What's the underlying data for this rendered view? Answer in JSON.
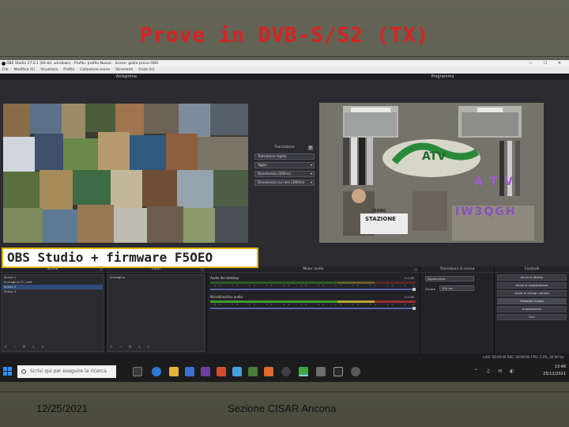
{
  "slide": {
    "title": "Prove in DVB-S/S2 (TX)",
    "callout": "OBS Studio + firmware F5OEO",
    "footer_date": "12/25/2021",
    "footer_center": "Sezione CISAR Ancona"
  },
  "window": {
    "title": "OBS Studio 27.0.1 (64-bit, windows) - Profilo: profilo-Nuovo - Scene: giallo-prova-OBS",
    "controls": "—  ☐  ✕"
  },
  "menu": [
    "File",
    "Modifica (E)",
    "Visualizza",
    "Profilo",
    "Collezione scene",
    "Strumenti",
    "Aiuto (H)"
  ],
  "panels": {
    "preview": "Anteprima",
    "program": "Programma"
  },
  "transition": {
    "header": "Transizione",
    "items": [
      "Transizione rapida",
      "Taglio",
      "Dissolvenza (300ms)",
      "Dissolvenza sul nero (300ms)"
    ]
  },
  "docks": {
    "scenes": {
      "title": "Scene",
      "items": [
        "Scena 1",
        "Immagine F5 / relè",
        "Scena 2",
        "Scena 3"
      ]
    },
    "sources": {
      "title": "Fonti",
      "items": [
        "Immagine"
      ]
    },
    "mixer": {
      "title": "Mixer audio",
      "channels": [
        {
          "name": "Audio del desktop",
          "db": "0.0 dB"
        },
        {
          "name": "Microfono/Aux audio",
          "db": "0.0 dB"
        }
      ],
      "scale": "-60 -55 -50 -45 -40 -35 -30 -25 -20 -15 -10 -5 0"
    },
    "transitions": {
      "title": "Transizioni di scena",
      "type": "Dissolvenza",
      "duration_label": "Durata",
      "duration": "300 ms"
    },
    "controls": {
      "title": "Controlli",
      "buttons": [
        "Avvia la diretta",
        "Avvia la registrazione",
        "Avvia la virtual camera",
        "Modalità Studio",
        "Impostazioni",
        "Esci"
      ]
    }
  },
  "status": {
    "text": "LIVE: 00:00:00   REC: 00:00:00   CPU: 2.2%, 30.00 fps"
  },
  "taskbar": {
    "search_placeholder": "Scrivi qui per eseguire la ricerca",
    "time": "13:48",
    "date": "25/12/2021"
  },
  "program_overlay": {
    "callsign_top": "I3ANG",
    "stazione": "STAZIONE",
    "atv": "ATV",
    "side_text": "A T V",
    "call_right": "IW3QGH"
  },
  "colors": {
    "title_red": "#d92222",
    "callout_border": "#e0b400",
    "obs_bg": "#1f1f23",
    "selection_blue": "#2e4d7b"
  }
}
